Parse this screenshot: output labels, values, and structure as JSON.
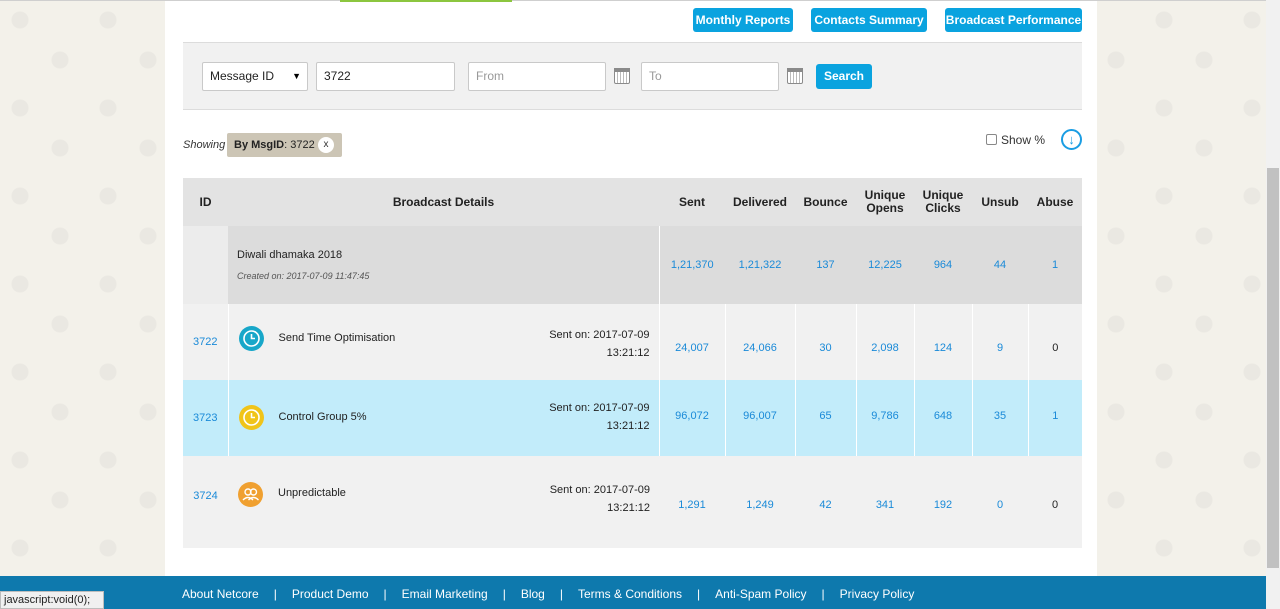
{
  "header_buttons": {
    "monthly_reports": "Monthly Reports",
    "contacts_summary": "Contacts Summary",
    "broadcast_performance": "Broadcast Performance"
  },
  "filter": {
    "select_value": "Message ID",
    "id_value": "3722",
    "from_placeholder": "From",
    "to_placeholder": "To",
    "search_label": "Search"
  },
  "showing": {
    "label": "Showing",
    "chip_key": "By MsgID",
    "chip_value": ": 3722",
    "chip_close": "x"
  },
  "show_percent_label": "Show %",
  "table": {
    "headers": {
      "id": "ID",
      "details": "Broadcast Details",
      "sent": "Sent",
      "delivered": "Delivered",
      "bounce": "Bounce",
      "unique_opens_1": "Unique",
      "unique_opens_2": "Opens",
      "unique_clicks_1": "Unique",
      "unique_clicks_2": "Clicks",
      "unsub": "Unsub",
      "abuse": "Abuse"
    },
    "group": {
      "name": "Diwali dhamaka 2018",
      "created": "Created on: 2017-07-09 11:47:45",
      "sent": "1,21,370",
      "delivered": "1,21,322",
      "bounce": "137",
      "unique_opens": "12,225",
      "unique_clicks": "964",
      "unsub": "44",
      "abuse": "1"
    },
    "rows": [
      {
        "id": "3722",
        "icon": "clock-icon",
        "icon_color": "#18a7c9",
        "name": "Send Time Optimisation",
        "sent_on_1": "Sent on: 2017-07-09",
        "sent_on_2": "13:21:12",
        "sent": "24,007",
        "delivered": "24,066",
        "bounce": "30",
        "unique_opens": "2,098",
        "unique_clicks": "124",
        "unsub": "9",
        "abuse": "0"
      },
      {
        "id": "3723",
        "icon": "clock-icon",
        "icon_color": "#f0c419",
        "name": "Control Group 5%",
        "sent_on_1": "Sent on: 2017-07-09",
        "sent_on_2": "13:21:12",
        "sent": "96,072",
        "delivered": "96,007",
        "bounce": "65",
        "unique_opens": "9,786",
        "unique_clicks": "648",
        "unsub": "35",
        "abuse": "1"
      },
      {
        "id": "3724",
        "icon": "users-icon",
        "icon_color": "#f0a030",
        "name": "Unpredictable",
        "sent_on_1": "Sent on: 2017-07-09",
        "sent_on_2": "13:21:12",
        "sent": "1,291",
        "delivered": "1,249",
        "bounce": "42",
        "unique_opens": "341",
        "unique_clicks": "192",
        "unsub": "0",
        "abuse": "0"
      }
    ]
  },
  "footer": {
    "links": [
      "About Netcore",
      "Product Demo",
      "Email Marketing",
      "Blog",
      "Terms & Conditions",
      "Anti-Spam Policy",
      "Privacy Policy"
    ],
    "separator": "|"
  },
  "status_bar": "javascript:void(0);",
  "colors": {
    "accent": "#0aa3df",
    "footer": "#0e79ad",
    "highlight_row": "#c2ecfa",
    "link": "#1a8ad8"
  }
}
